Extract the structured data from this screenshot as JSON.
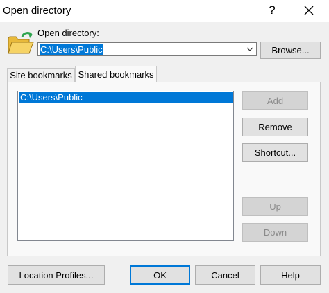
{
  "window": {
    "title": "Open directory",
    "help_glyph": "?",
    "close_icon": "close-icon"
  },
  "open_directory": {
    "label": "Open directory:",
    "value": "C:\\Users\\Public",
    "icon": "open-folder-icon",
    "browse_label": "Browse..."
  },
  "tabs": [
    {
      "label": "Site bookmarks",
      "selected": false
    },
    {
      "label": "Shared bookmarks",
      "selected": true
    }
  ],
  "bookmarks": {
    "items": [
      {
        "label": "C:\\Users\\Public",
        "selected": true
      }
    ],
    "buttons": {
      "add": "Add",
      "remove": "Remove",
      "shortcut": "Shortcut...",
      "up": "Up",
      "down": "Down"
    }
  },
  "footer": {
    "location_profiles": "Location Profiles...",
    "ok": "OK",
    "cancel": "Cancel",
    "help": "Help"
  },
  "colors": {
    "selection": "#0078d7",
    "folder_yellow": "#f6d365",
    "folder_arrow_green": "#2ea44f"
  }
}
